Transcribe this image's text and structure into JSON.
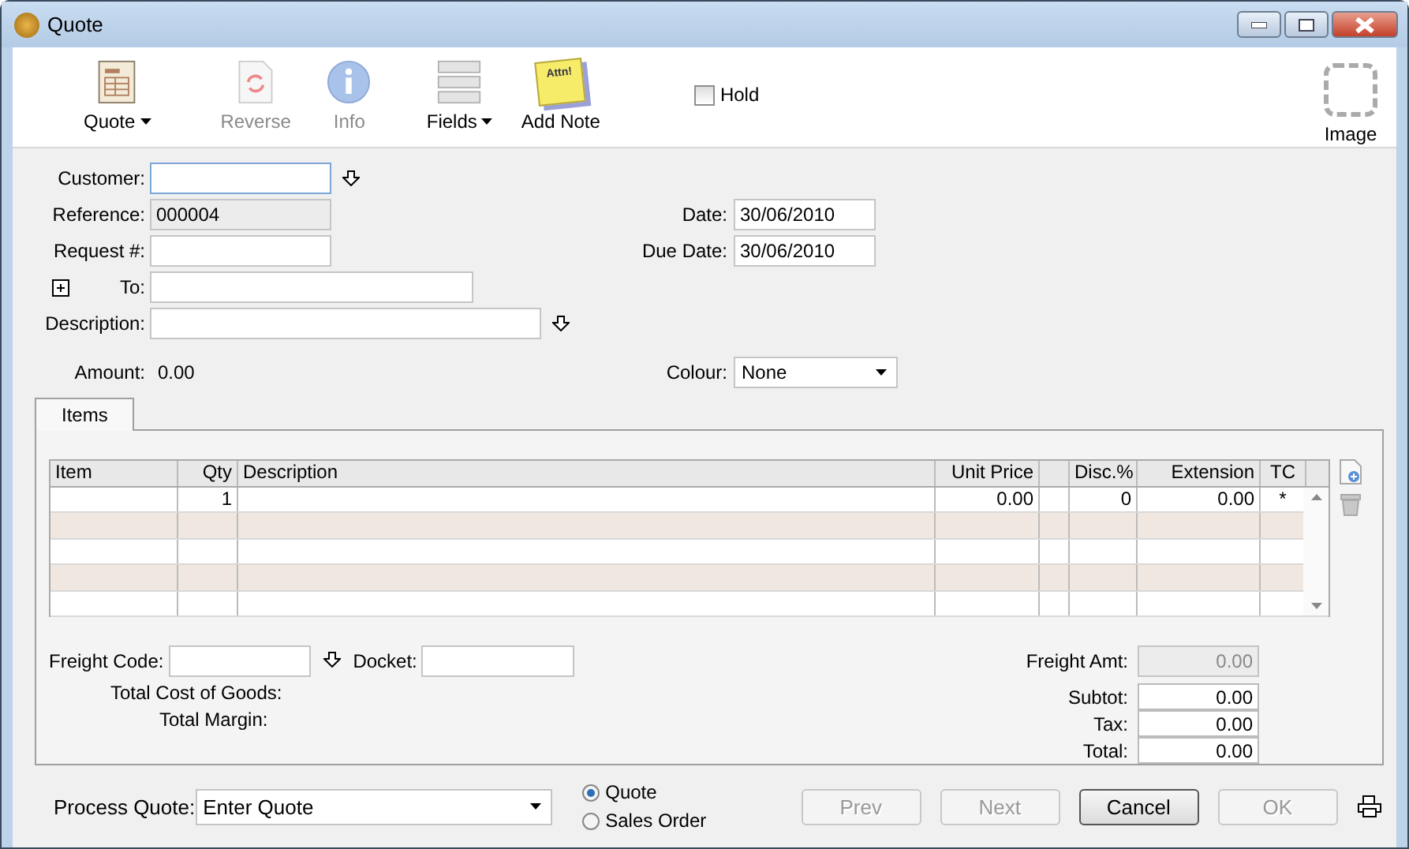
{
  "window": {
    "title": "Quote"
  },
  "toolbar": {
    "buttons": [
      {
        "kind": "quote",
        "label": "Quote",
        "disabled": false,
        "dropdown": true
      },
      {
        "kind": "reverse",
        "label": "Reverse",
        "disabled": true,
        "dropdown": false
      },
      {
        "kind": "info",
        "label": "Info",
        "disabled": true,
        "dropdown": false
      },
      {
        "kind": "fields",
        "label": "Fields",
        "disabled": false,
        "dropdown": true
      },
      {
        "kind": "note",
        "label": "Add Note",
        "disabled": false,
        "dropdown": false,
        "icon_text": "Attn!"
      }
    ],
    "hold": {
      "label": "Hold",
      "checked": false
    },
    "image": {
      "label": "Image"
    }
  },
  "form": {
    "customer": {
      "label": "Customer:"
    },
    "reference": {
      "label": "Reference:",
      "value": "000004",
      "readonly": true
    },
    "request": {
      "label": "Request #:"
    },
    "to": {
      "label": "To:"
    },
    "description": {
      "label": "Description:"
    },
    "amount": {
      "label": "Amount:",
      "value": "0.00"
    },
    "date": {
      "label": "Date:",
      "value": "30/06/2010"
    },
    "due_date": {
      "label": "Due Date:",
      "value": "30/06/2010"
    },
    "colour": {
      "label": "Colour:",
      "value": "None"
    }
  },
  "tabs": [
    {
      "label": "Items",
      "selected": true
    }
  ],
  "table": {
    "columns": [
      {
        "kind": "text",
        "label": "Item"
      },
      {
        "kind": "text",
        "label": "Qty"
      },
      {
        "kind": "text",
        "label": "Description"
      },
      {
        "kind": "text",
        "label": "Unit Price"
      },
      {
        "kind": "blank"
      },
      {
        "kind": "text",
        "label": "Disc.%"
      },
      {
        "kind": "text",
        "label": "Extension"
      },
      {
        "kind": "text",
        "label": "TC"
      }
    ],
    "rows": [
      {
        "qty": "1",
        "unit_price": "0.00",
        "disc": "0",
        "extension": "0.00",
        "tc": "*"
      }
    ]
  },
  "freight": {
    "freight_code": {
      "label": "Freight Code:"
    },
    "docket": {
      "label": "Docket:"
    },
    "total_cost_label": "Total Cost of Goods:",
    "total_margin_label": "Total Margin:"
  },
  "totals": [
    {
      "label": "Freight Amt:",
      "value": "0.00",
      "readonly": true
    },
    {
      "label": "Subtot:",
      "value": "0.00",
      "readonly": false
    },
    {
      "label": "Tax:",
      "value": "0.00",
      "readonly": false
    },
    {
      "label": "Total:",
      "value": "0.00",
      "readonly": false
    }
  ],
  "footer": {
    "process": {
      "label": "Process Quote:",
      "value": "Enter Quote"
    },
    "radios": [
      {
        "label": "Quote",
        "selected": true
      },
      {
        "label": "Sales Order",
        "selected": false
      }
    ],
    "buttons": [
      {
        "label": "Prev",
        "disabled": true
      },
      {
        "label": "Next",
        "disabled": true
      },
      {
        "label": "Cancel",
        "disabled": false
      },
      {
        "label": "OK",
        "disabled": true
      }
    ]
  }
}
